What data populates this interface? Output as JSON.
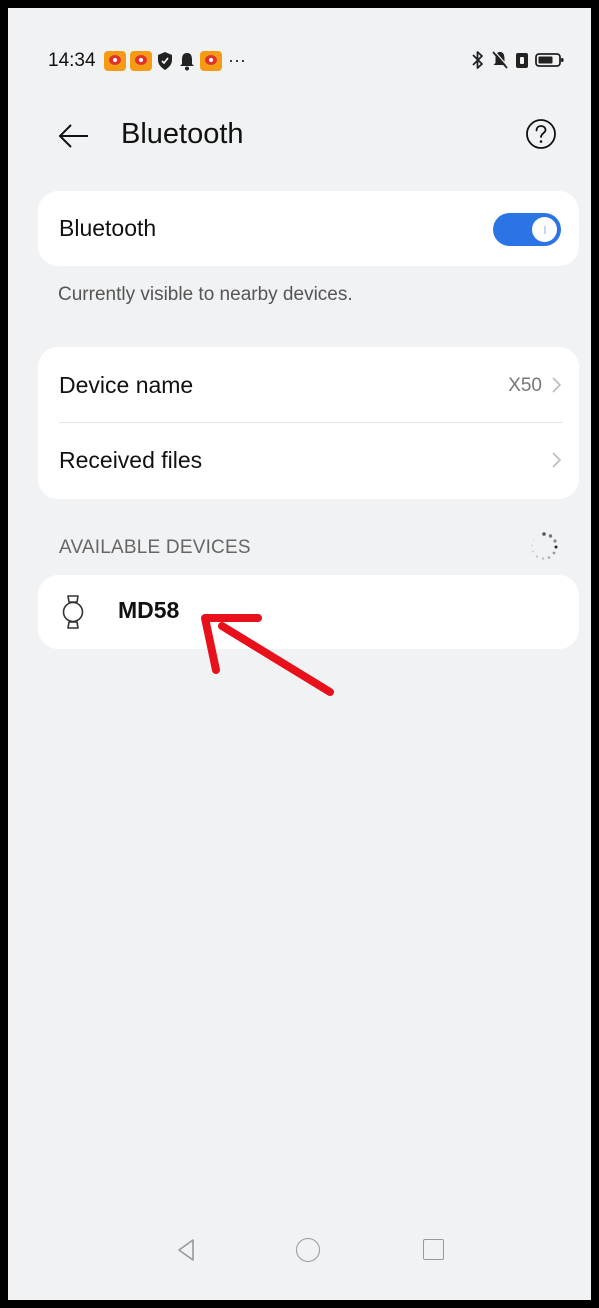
{
  "status_bar": {
    "time": "14:34",
    "more": "···",
    "icons": [
      "weibo-icon",
      "weibo-icon",
      "shield-icon",
      "bell-icon",
      "weibo-icon",
      "bluetooth-icon",
      "mute-icon",
      "sim-icon",
      "battery-icon"
    ]
  },
  "header": {
    "title": "Bluetooth",
    "back_icon": "back-arrow-icon",
    "help_icon": "help-icon"
  },
  "bluetooth_toggle": {
    "label": "Bluetooth",
    "enabled": true,
    "visibility_text": "Currently visible to nearby devices."
  },
  "settings": {
    "device_name_label": "Device name",
    "device_name_value": "X50",
    "received_files_label": "Received files"
  },
  "available_devices": {
    "section_title": "AVAILABLE DEVICES",
    "devices": [
      {
        "name": "MD58",
        "icon": "watch-icon"
      }
    ]
  },
  "annotation": {
    "arrow_color": "#e8101a"
  },
  "colors": {
    "accent": "#2b74e6",
    "background": "#f1f2f4"
  }
}
